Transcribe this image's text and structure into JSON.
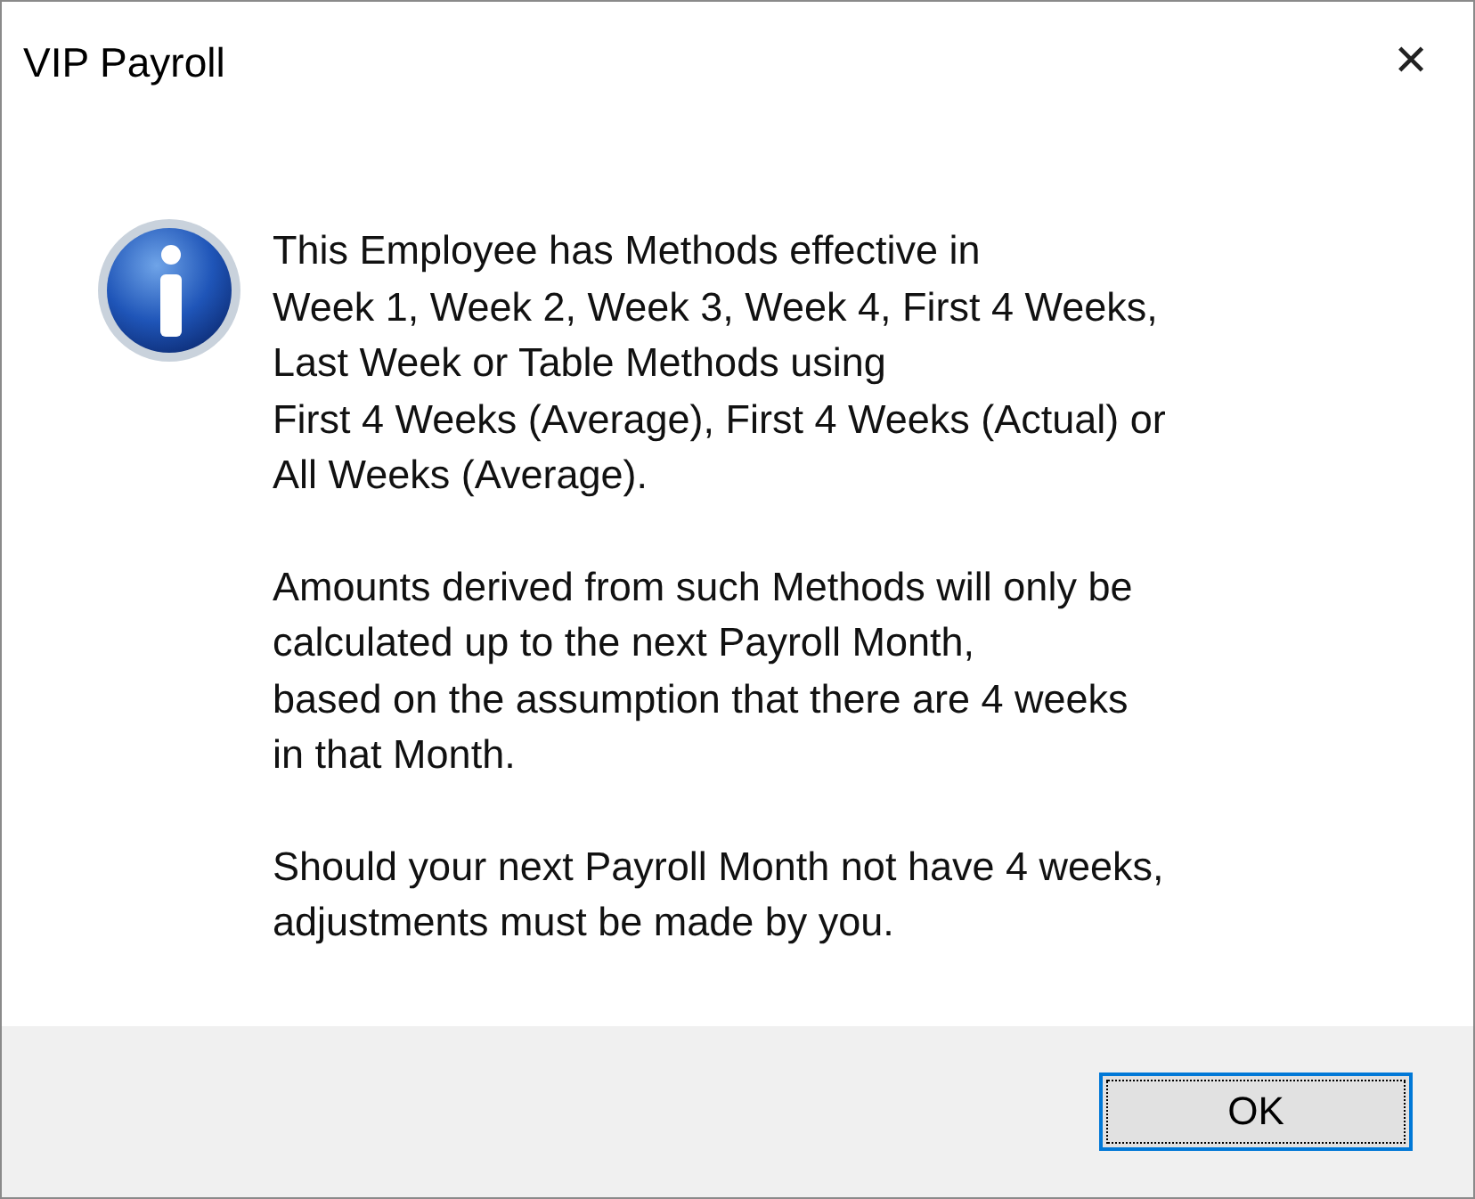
{
  "window": {
    "title": "VIP Payroll",
    "close": "✕"
  },
  "message": {
    "paragraphs": [
      [
        "This Employee has Methods effective in",
        "Week 1, Week 2, Week 3, Week 4, First 4 Weeks,",
        "Last Week or Table Methods using",
        "First 4 Weeks (Average), First 4 Weeks (Actual) or",
        "All Weeks (Average)."
      ],
      [
        "Amounts derived from such Methods will only be",
        "calculated up to the next Payroll Month,",
        "based on the assumption that there are 4 weeks",
        "in that Month."
      ],
      [
        "Should your next Payroll Month not have 4 weeks,",
        "adjustments must be made by you."
      ]
    ]
  },
  "buttons": [
    {
      "label": "OK",
      "focused": true
    }
  ]
}
